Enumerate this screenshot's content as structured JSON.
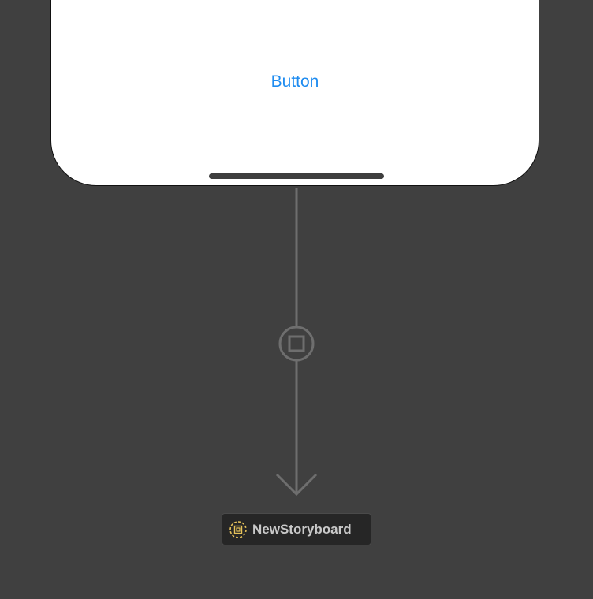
{
  "device": {
    "button_label": "Button"
  },
  "segue": {
    "icon": "segue-square-icon"
  },
  "storyboard_reference": {
    "label": "NewStoryboard",
    "icon": "storyboard-reference-icon",
    "icon_color": "#e6c25a"
  },
  "colors": {
    "canvas_background": "#404040",
    "button_tint": "#1f8cf0",
    "segue_line": "#6e6e6e"
  }
}
